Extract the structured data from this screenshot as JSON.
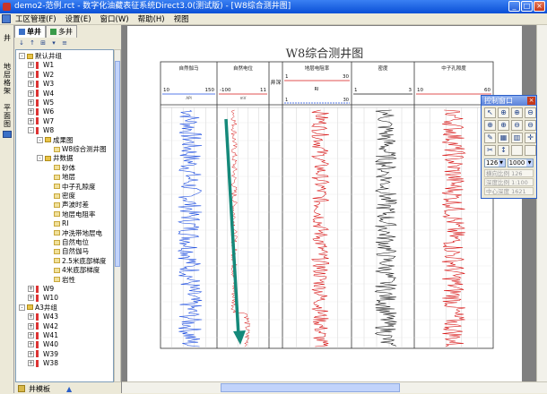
{
  "window": {
    "title": "demo2-范例.rct - 数字化油藏表征系统Direct3.0(测试版) - [W8综合测井图]",
    "buttons": [
      "_",
      "□",
      "×"
    ]
  },
  "menu": {
    "items": [
      "工区管理(F)",
      "设置(E)",
      "窗口(W)",
      "帮助(H)",
      "视图"
    ]
  },
  "left_strip": {
    "labels": [
      "井",
      "地层格架",
      "平面图"
    ]
  },
  "panel": {
    "tabs": [
      "单井",
      "多井"
    ],
    "toolbar": [
      "↓",
      "↑",
      "⊞",
      "▾",
      "≡"
    ],
    "bottom_label": "井模板",
    "bottom_arrow": "▲"
  },
  "tree": [
    {
      "level": 0,
      "exp": "-",
      "icon": "folder",
      "label": "默认井组"
    },
    {
      "level": 1,
      "exp": "+",
      "icon": "well",
      "label": "W1"
    },
    {
      "level": 1,
      "exp": "+",
      "icon": "well",
      "label": "W2"
    },
    {
      "level": 1,
      "exp": "+",
      "icon": "well",
      "label": "W3"
    },
    {
      "level": 1,
      "exp": "+",
      "icon": "well",
      "label": "W4"
    },
    {
      "level": 1,
      "exp": "+",
      "icon": "well",
      "label": "W5"
    },
    {
      "level": 1,
      "exp": "+",
      "icon": "well",
      "label": "W6"
    },
    {
      "level": 1,
      "exp": "+",
      "icon": "well",
      "label": "W7"
    },
    {
      "level": 1,
      "exp": "-",
      "icon": "well",
      "label": "W8"
    },
    {
      "level": 2,
      "exp": "-",
      "icon": "folder",
      "label": "成果图"
    },
    {
      "level": 3,
      "exp": "",
      "icon": "leaf",
      "label": "W8综合测井图"
    },
    {
      "level": 2,
      "exp": "-",
      "icon": "folder",
      "label": "井数据"
    },
    {
      "level": 3,
      "exp": "",
      "icon": "leaf",
      "label": "砂体"
    },
    {
      "level": 3,
      "exp": "",
      "icon": "leaf",
      "label": "地层"
    },
    {
      "level": 3,
      "exp": "",
      "icon": "leaf",
      "label": "中子孔隙度"
    },
    {
      "level": 3,
      "exp": "",
      "icon": "leaf",
      "label": "密度"
    },
    {
      "level": 3,
      "exp": "",
      "icon": "leaf",
      "label": "声波时差"
    },
    {
      "level": 3,
      "exp": "",
      "icon": "leaf",
      "label": "地层电阻率"
    },
    {
      "level": 3,
      "exp": "",
      "icon": "leaf",
      "label": "RI"
    },
    {
      "level": 3,
      "exp": "",
      "icon": "leaf",
      "label": "冲洗带地层电"
    },
    {
      "level": 3,
      "exp": "",
      "icon": "leaf",
      "label": "自然电位"
    },
    {
      "level": 3,
      "exp": "",
      "icon": "leaf",
      "label": "自然伽马"
    },
    {
      "level": 3,
      "exp": "",
      "icon": "leaf",
      "label": "2.5米底部梯度"
    },
    {
      "level": 3,
      "exp": "",
      "icon": "leaf",
      "label": "4米底部梯度"
    },
    {
      "level": 3,
      "exp": "",
      "icon": "leaf",
      "label": "岩性"
    },
    {
      "level": 1,
      "exp": "+",
      "icon": "well",
      "label": "W9"
    },
    {
      "level": 1,
      "exp": "+",
      "icon": "well",
      "label": "W10"
    },
    {
      "level": 0,
      "exp": "-",
      "icon": "folder",
      "label": "A3井组"
    },
    {
      "level": 1,
      "exp": "+",
      "icon": "well",
      "label": "W43"
    },
    {
      "level": 1,
      "exp": "+",
      "icon": "well",
      "label": "W42"
    },
    {
      "level": 1,
      "exp": "+",
      "icon": "well",
      "label": "W41"
    },
    {
      "level": 1,
      "exp": "+",
      "icon": "well",
      "label": "W40"
    },
    {
      "level": 1,
      "exp": "+",
      "icon": "well",
      "label": "W39"
    },
    {
      "level": 1,
      "exp": "+",
      "icon": "well",
      "label": "W38"
    }
  ],
  "logplot": {
    "title": "W8综合测井图",
    "depth_label": "井深",
    "tracks": [
      {
        "name": "自然伽马",
        "min": "10",
        "max": "150",
        "unit": "API",
        "color": "#1f4fe0"
      },
      {
        "name": "自然电位",
        "min": "-100",
        "max": "11",
        "unit": "mV",
        "color": "#d81818"
      },
      {
        "name": "地层电阻率",
        "min": "1",
        "max": "30",
        "unit": "",
        "color": "#d81818"
      },
      {
        "name": "密度",
        "min": "1",
        "max": "3",
        "unit": "",
        "color": "#111111"
      },
      {
        "name": "中子孔隙度",
        "min": "10",
        "max": "60",
        "unit": "",
        "color": "#d81818"
      }
    ],
    "extra_header": {
      "label": "RI",
      "min": "1",
      "max": "30"
    }
  },
  "control": {
    "title": "控制窗口",
    "close": "×",
    "buttons": [
      "↖",
      "⊕",
      "⊕",
      "⊖",
      "⊕",
      "⊕",
      "⊖",
      "⊖",
      "✎",
      "▦",
      "▥",
      "✛",
      "✂",
      "↕",
      "",
      ""
    ],
    "select1": "126",
    "select2": "1000",
    "fields": [
      "横向比例  126",
      "深度比例  1:100",
      "中心深度  1621"
    ]
  },
  "annotation_color": "#15897a"
}
